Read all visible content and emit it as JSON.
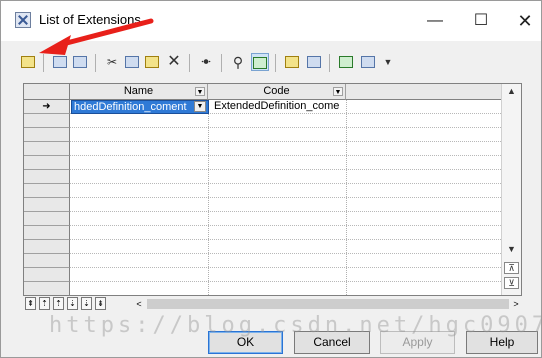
{
  "window": {
    "title": "List of Extensions",
    "minimize_glyph": "—",
    "maximize_glyph": "☐",
    "close_glyph": "✕"
  },
  "toolbar": {
    "icons": [
      "properties-icon",
      "add-row-icon",
      "insert-row-icon",
      "cut-icon",
      "copy-icon",
      "paste-icon",
      "delete-icon",
      "find-icon",
      "filter-icon",
      "enable-filter-icon",
      "export-icon",
      "import-icon",
      "excel-icon",
      "print-icon",
      "dropdown-icon"
    ]
  },
  "grid": {
    "columns": [
      {
        "label": "Name",
        "dropdown": "▼"
      },
      {
        "label": "Code",
        "dropdown": "▼"
      }
    ],
    "rows": [
      {
        "marker": "➜",
        "name": "hdedDefinition_coment",
        "code": "ExtendedDefinition_come"
      }
    ],
    "cell_dropdown": "▼"
  },
  "vscroll": {
    "up": "▲",
    "down": "▼",
    "top": "⊼",
    "bottom": "⊻"
  },
  "nav": {
    "buttons": [
      "⇞",
      "⇡",
      "⇡",
      "⇣",
      "⇣",
      "⇟"
    ]
  },
  "hscroll": {
    "left": "<",
    "right": ">"
  },
  "buttons": {
    "ok": "OK",
    "cancel": "Cancel",
    "apply": "Apply",
    "help": "Help"
  },
  "watermark": "https://blog.csdn.net/hgc0907",
  "colors": {
    "selection": "#2f7ad6",
    "annotation_arrow": "#e8201a"
  }
}
